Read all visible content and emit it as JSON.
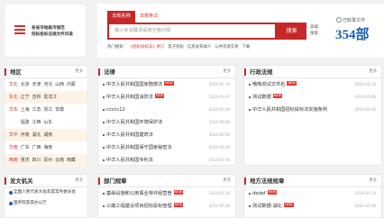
{
  "logo": {
    "line1": "各省市地级市规范",
    "line2": "招标投标法规文件目录"
  },
  "search": {
    "tabs": [
      "法规名称",
      "法规条文"
    ],
    "placeholder": "输入多关键词请用空格分隔",
    "button": "搜索",
    "advanced": "高级搜索",
    "collected_label": "已收录文件",
    "collected_count": "354部",
    "hot_label": "热门搜索：",
    "hot_items": [
      "《招标投标法》修订",
      "电子招标",
      "信息发布媒介",
      "公共资源交易",
      "下载"
    ]
  },
  "region": {
    "title": "地区",
    "more": "更多",
    "rows": [
      {
        "zone": "华北",
        "cells": [
          "北京",
          "天津",
          "河北",
          "山西",
          "内蒙"
        ]
      },
      {
        "zone": "东北",
        "cells": [
          "辽宁",
          "吉林",
          "黑龙江"
        ]
      },
      {
        "zone": "华东",
        "cells": [
          "上海",
          "江苏",
          "浙江",
          "安徽"
        ]
      },
      {
        "zone": "",
        "cells": [
          "福建",
          "江西",
          "山东"
        ]
      },
      {
        "zone": "华中",
        "cells": [
          "河南",
          "湖北",
          "湖南"
        ]
      },
      {
        "zone": "华南",
        "cells": [
          "广东",
          "广西",
          "海南"
        ]
      },
      {
        "zone": "西南",
        "cells": [
          "重庆",
          "四川",
          "贵州",
          "云南",
          "西藏"
        ]
      }
    ]
  },
  "law": {
    "title": "法律",
    "more": "更多",
    "items": [
      {
        "text": "中华人民共和国国家赔偿法",
        "new": "NEW",
        "date": "2024-05-10"
      },
      {
        "text": "中华人民共和国消防法",
        "new": "NEW",
        "date": "2024-05-07"
      },
      {
        "text": "ccccc12",
        "new": "",
        "date": "2024-05-06"
      },
      {
        "text": "中华人民共和国环境保护法",
        "new": "",
        "date": "2024-05-06"
      },
      {
        "text": "中华人民共和国建筑法",
        "new": "",
        "date": "2024-05-06"
      },
      {
        "text": "中华人民共和国保守国家秘密法",
        "new": "",
        "date": "2024-05-06"
      },
      {
        "text": "中华人民共和国专利法",
        "new": "",
        "date": "2024-05-06"
      }
    ]
  },
  "admin": {
    "title": "行政法规",
    "more": "更多",
    "items": [
      {
        "text": "哦哦测试文件名",
        "new": "NEW",
        "date": "2024-05-10"
      },
      {
        "text": "测试数据",
        "new": "NEW",
        "date": "2024-05-06"
      },
      {
        "text": "中华人民共和国招标投标法实施条例",
        "new": "",
        "date": "2024-05-06"
      }
    ]
  },
  "docs": {
    "title": "发文机关",
    "more": "更多",
    "items": [
      "全国人民代表大会及其常务委员会",
      "国务院及其办公厅"
    ]
  },
  "dept": {
    "title": "部门规章",
    "more": "更多",
    "items": [
      {
        "text": "基础设施和公用事业特许经营管",
        "new": "NEW",
        "date": "2024-05-10"
      },
      {
        "text": "公路工程建设项目招标投标管理",
        "new": "NEW",
        "date": "2024-05-06"
      }
    ]
  },
  "local": {
    "title": "地方法规规章",
    "more": "更多",
    "items": [
      {
        "text": "dedef",
        "new": "NEW",
        "date": "2024-05-10"
      },
      {
        "text": "测试数据-湖北",
        "new": "NEW",
        "date": "2024-05-06"
      }
    ]
  }
}
